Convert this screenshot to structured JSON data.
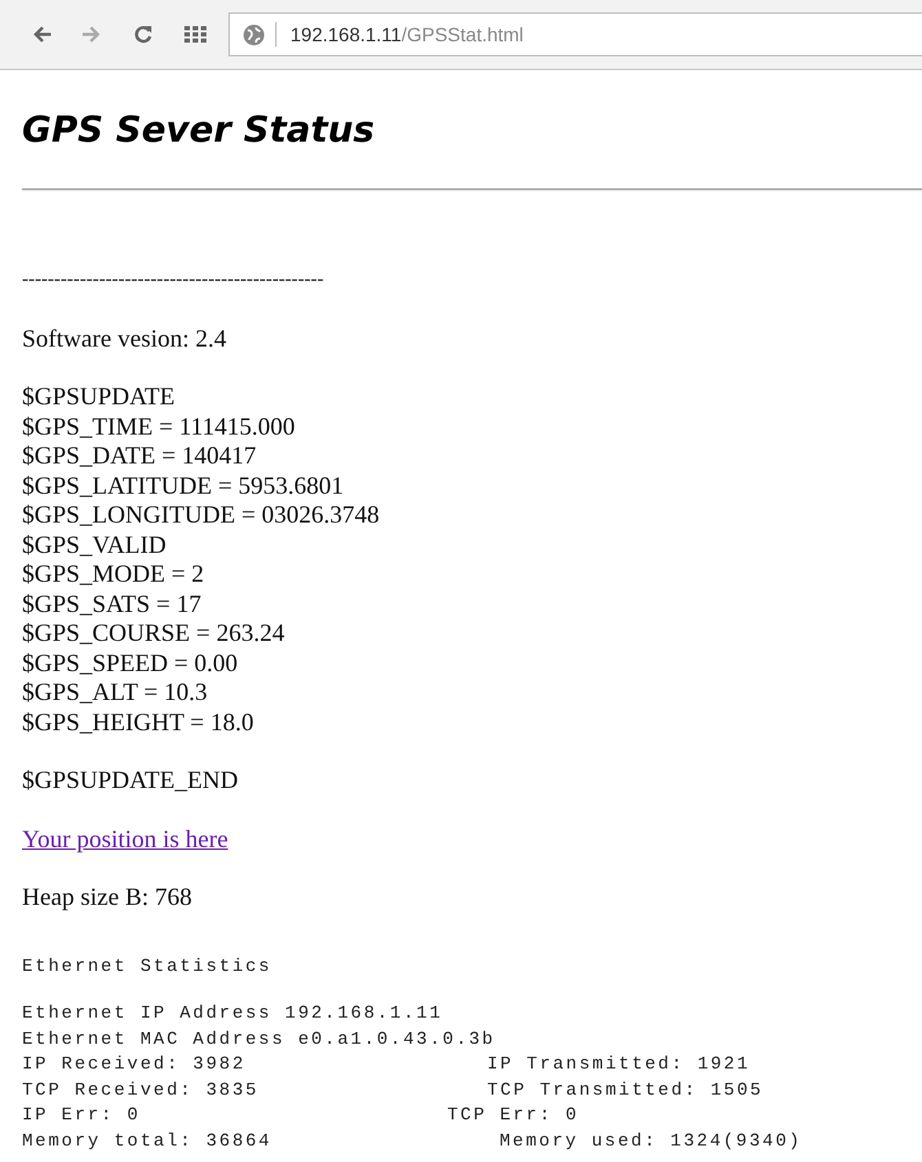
{
  "browser": {
    "url_host": "192.168.1.11",
    "url_path": "/GPSStat.html"
  },
  "heading": "GPS Sever Status",
  "separator": "-----------------------------------------------",
  "software_version": "Software vesion: 2.4",
  "gps_update": [
    "$GPSUPDATE",
    "$GPS_TIME = 111415.000",
    "$GPS_DATE = 140417",
    "$GPS_LATITUDE = 5953.6801",
    "$GPS_LONGITUDE = 03026.3748",
    "$GPS_VALID",
    "$GPS_MODE = 2",
    "$GPS_SATS = 17",
    "$GPS_COURSE = 263.24",
    "$GPS_SPEED = 0.00",
    "$GPS_ALT = 10.3",
    "$GPS_HEIGHT = 18.0"
  ],
  "gps_update_end": "$GPSUPDATE_END",
  "position_link": {
    "label": "Your position is here",
    "visited": true
  },
  "heap_size": "Heap size B: 768",
  "ethernet": {
    "title": "Ethernet Statistics",
    "lines": [
      "Ethernet IP Address 192.168.1.11",
      "Ethernet MAC Address e0.a1.0.43.0.3b"
    ],
    "pairs": [
      {
        "left": "IP Received: 3982",
        "right": "IP Transmitted: 1921"
      },
      {
        "left": "TCP Received: 3835",
        "right": "TCP Transmitted: 1505"
      },
      {
        "left": "IP Err: 0",
        "right": "TCP Err: 0"
      },
      {
        "left": "Memory total: 36864",
        "right": "Memory used: 1324(9340)"
      }
    ]
  }
}
